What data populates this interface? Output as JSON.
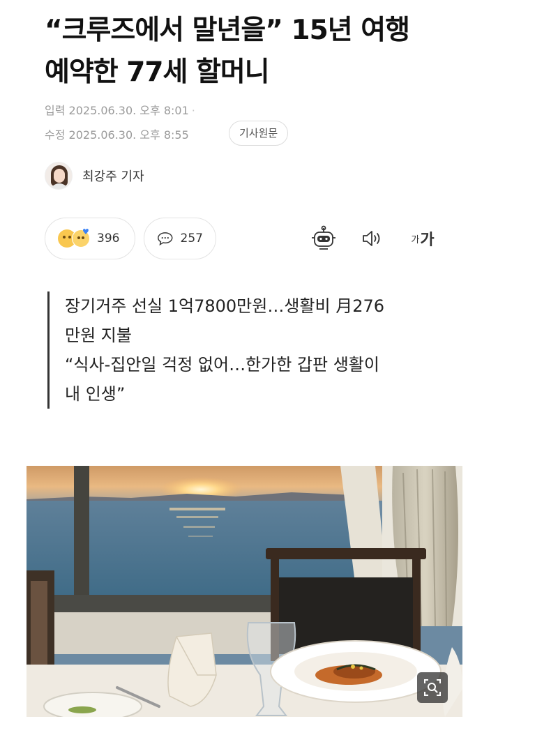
{
  "article": {
    "title_line1": "“크루즈에서 말년을” 15년 여행",
    "title_line2": "예약한 77세 할머니",
    "published": "입력 2025.06.30. 오후 8:01",
    "modified": "수정 2025.06.30. 오후 8:55",
    "source_button": "기사원문",
    "author": "최강주 기자",
    "reactions_count": "396",
    "comments_count": "257",
    "font_size_label_small": "가",
    "font_size_label_large": "가",
    "summary": [
      "장기거주 선실 1억7800만원…생활비 月276",
      "만원 지불",
      "“식사-집안일 걱정 없어…한가한 갑판 생활이",
      "내 인생”"
    ]
  },
  "icons": {
    "reaction": "emoji-reaction-icon",
    "comment": "speech-bubble-icon",
    "robot": "ai-summary-robot-icon",
    "speaker": "speaker-icon",
    "zoom": "zoom-magnifier-icon"
  },
  "colors": {
    "text": "#111111",
    "meta": "#9a9a9a",
    "border": "#e3e3e3"
  }
}
